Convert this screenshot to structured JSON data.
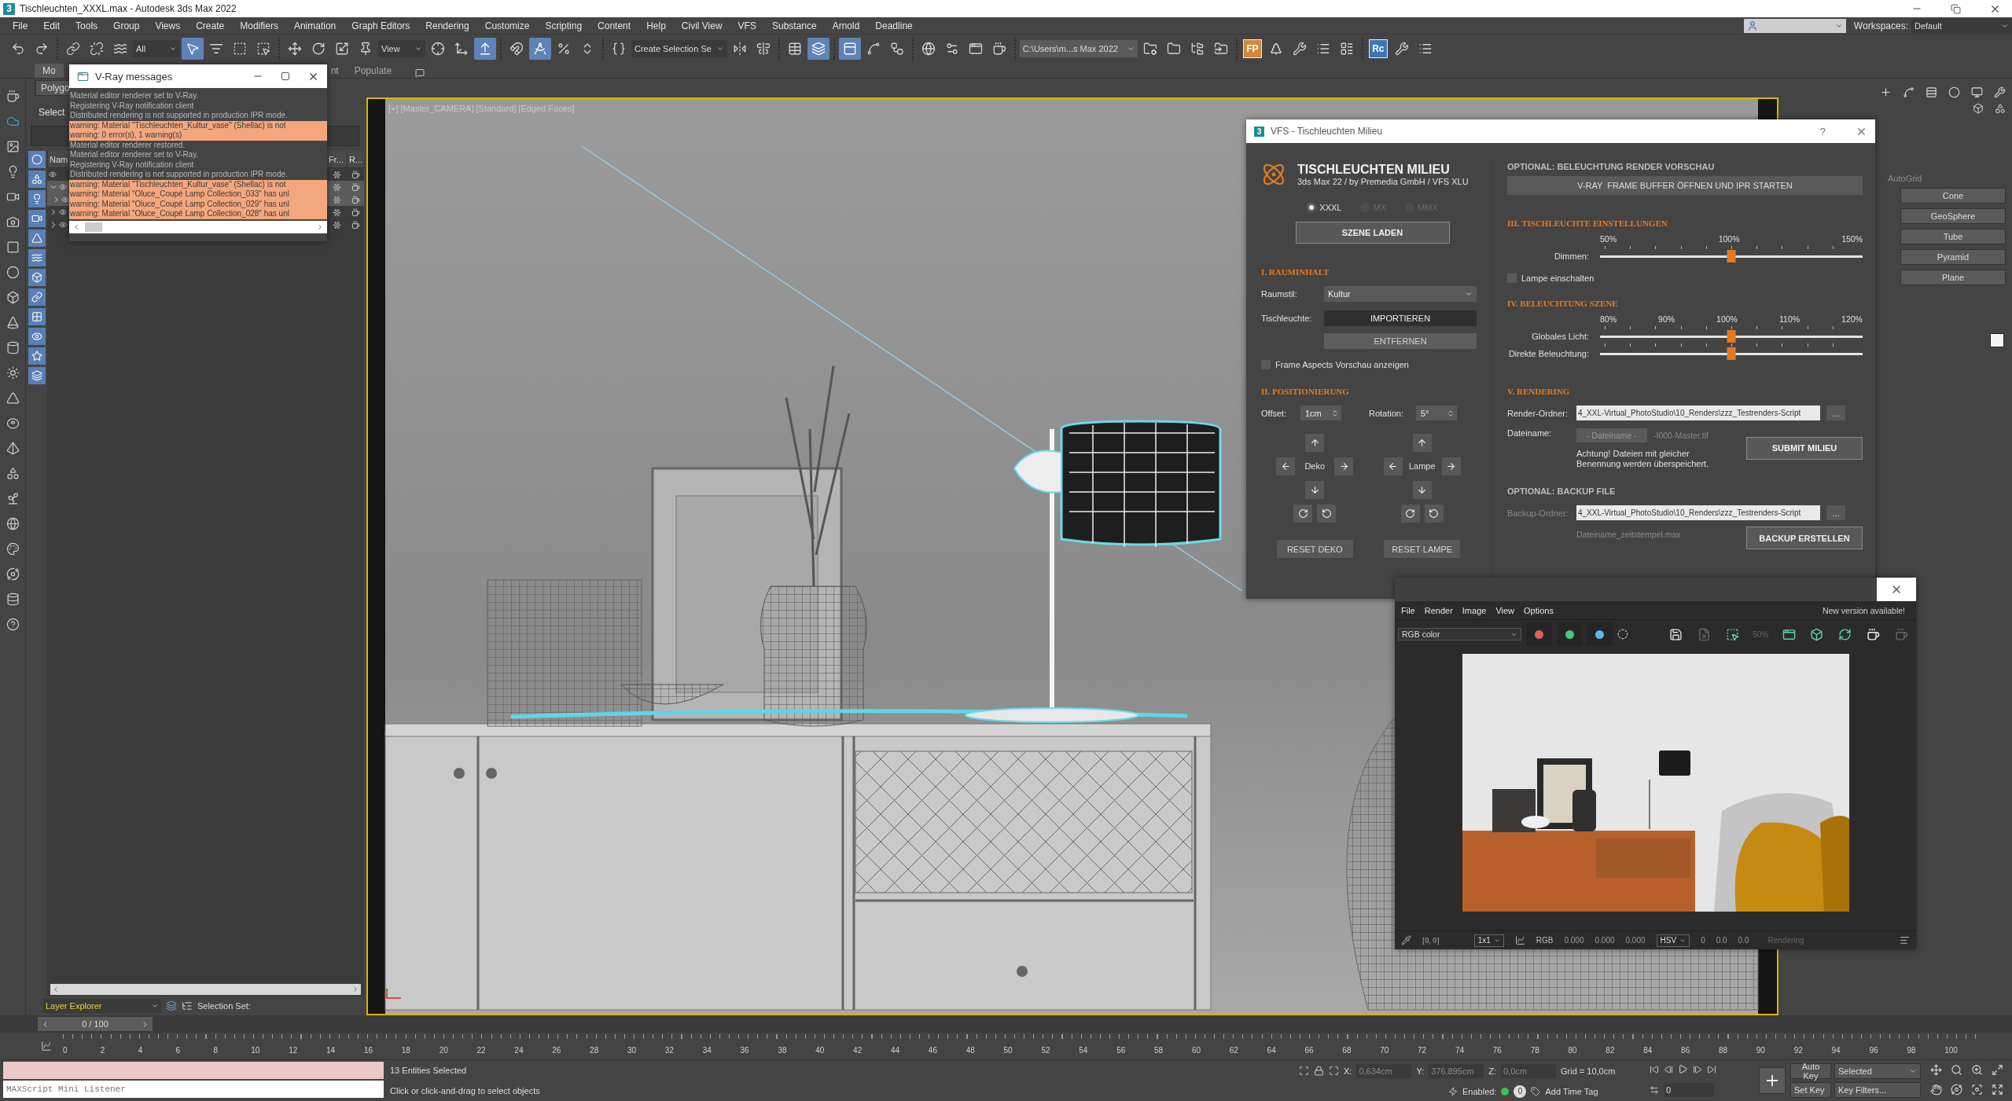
{
  "window": {
    "logo": "3",
    "title": "Tischleuchten_XXXL.max - Autodesk 3ds Max 2022"
  },
  "menu": [
    "File",
    "Edit",
    "Tools",
    "Group",
    "Views",
    "Create",
    "Modifiers",
    "Animation",
    "Graph Editors",
    "Rendering",
    "Customize",
    "Scripting",
    "Content",
    "Help",
    "Civil View",
    "VFS",
    "Substance",
    "Arnold",
    "Deadline"
  ],
  "workspace": {
    "label": "Workspaces:",
    "value": "Default"
  },
  "toolbar": [
    [
      {
        "kind": "button",
        "on": false
      },
      {
        "kind": "button",
        "on": false
      }
    ],
    [
      {
        "kind": "button",
        "on": false
      },
      {
        "kind": "button",
        "on": false
      },
      {
        "kind": "button",
        "on": false
      },
      {
        "kind": "dropdown",
        "value": "All"
      },
      {
        "kind": "button",
        "on": true
      },
      {
        "kind": "button",
        "on": false
      },
      {
        "kind": "button",
        "on": false
      },
      {
        "kind": "button",
        "on": false
      }
    ],
    [
      {
        "kind": "button",
        "on": false
      },
      {
        "kind": "button",
        "on": false
      },
      {
        "kind": "button",
        "on": false
      },
      {
        "kind": "button",
        "on": false
      },
      {
        "kind": "dropdown",
        "value": "View"
      },
      {
        "kind": "button",
        "on": false
      },
      {
        "kind": "button",
        "on": false
      },
      {
        "kind": "button",
        "on": true
      }
    ],
    [
      {
        "kind": "button",
        "on": false
      },
      {
        "kind": "button",
        "on": true
      },
      {
        "kind": "button",
        "on": false
      },
      {
        "kind": "button",
        "on": false
      }
    ],
    [
      {
        "kind": "button",
        "on": false
      },
      {
        "kind": "dropdown",
        "value": "Create Selection Se"
      },
      {
        "kind": "button",
        "on": false
      },
      {
        "kind": "button",
        "on": false
      }
    ],
    [
      {
        "kind": "button",
        "on": false
      },
      {
        "kind": "button",
        "on": true
      }
    ],
    [
      {
        "kind": "button",
        "on": true
      },
      {
        "kind": "button",
        "on": false
      },
      {
        "kind": "button",
        "on": false
      }
    ],
    [
      {
        "kind": "button",
        "on": false
      },
      {
        "kind": "button",
        "on": false
      },
      {
        "kind": "button",
        "on": false
      },
      {
        "kind": "button",
        "on": false
      }
    ],
    [
      {
        "kind": "dropdown",
        "value": "C:\\Users\\m...s Max 2022"
      },
      {
        "kind": "button",
        "on": false
      },
      {
        "kind": "button",
        "on": false
      },
      {
        "kind": "button",
        "on": false
      },
      {
        "kind": "button",
        "on": false
      }
    ],
    [
      {
        "kind": "text",
        "label": "FP",
        "color": "#d0883a"
      },
      {
        "kind": "button",
        "on": false
      },
      {
        "kind": "button",
        "on": false
      },
      {
        "kind": "button",
        "on": false
      },
      {
        "kind": "button",
        "on": false
      }
    ],
    [
      {
        "kind": "text",
        "label": "Rc",
        "color": "#3c78b4"
      },
      {
        "kind": "button",
        "on": false
      },
      {
        "kind": "button",
        "on": false
      }
    ]
  ],
  "ribbon_tabs": [
    {
      "label": "Mo",
      "selected": true
    },
    {
      "label": "nt",
      "selected": false
    },
    {
      "label": "Populate",
      "selected": false
    }
  ],
  "explorer": {
    "ribbon_dropdown": "Polygo",
    "menu": "Select",
    "columns": [
      "Nam",
      "Fr...",
      "R..."
    ],
    "rows": [
      {
        "selected": false
      },
      {
        "expanded": true,
        "selected": true,
        "children": [
          {
            "expanded": false,
            "selected": true
          }
        ]
      },
      {
        "expanded": false,
        "selected": false
      },
      {
        "expanded": false,
        "selected": false
      }
    ],
    "layer_explorer": "Layer Explorer",
    "selection_set": "Selection Set:"
  },
  "vray_messages": {
    "title": "V-Ray messages",
    "lines": [
      {
        "kind": "info",
        "text": "Material editor renderer set to V-Ray."
      },
      {
        "kind": "info",
        "text": "Registering V-Ray notification client"
      },
      {
        "kind": "info",
        "text": "Distributed rendering is not supported in production IPR mode."
      },
      {
        "kind": "warning",
        "text": "warning: Material \"Tischleuchten_Kultur_vase\" (Shellac) is not"
      },
      {
        "kind": "warning",
        "text": "warning: 0 error(s), 1 warning(s)"
      },
      {
        "kind": "info",
        "text": "Material editor renderer restored."
      },
      {
        "kind": "info",
        "text": "Material editor renderer set to V-Ray."
      },
      {
        "kind": "info",
        "text": "Registering V-Ray notification client"
      },
      {
        "kind": "info",
        "text": "Distributed rendering is not supported in production IPR mode."
      },
      {
        "kind": "warning",
        "text": "warning: Material \"Tischleuchten_Kultur_vase\" (Shellac) is not"
      },
      {
        "kind": "warning",
        "text": "warning: Material \"Oluce_Coupé Lamp Collection_033\" has unl"
      },
      {
        "kind": "warning",
        "text": "warning: Material \"Oluce_Coupé Lamp Collection_029\" has unl"
      },
      {
        "kind": "warning",
        "text": "warning: Material \"Oluce_Coupé Lamp Collection_028\" has unl"
      }
    ]
  },
  "viewport": {
    "label": "[+] [Master_CAMERA] [Standard] [Edged Faces]"
  },
  "command_panel": {
    "autogrid": "AutoGrid",
    "primitives": [
      "Cone",
      "GeoSphere",
      "Tube",
      "Pyramid",
      "Plane"
    ]
  },
  "vfs_dialog": {
    "logo": "3",
    "title": "VFS - Tischleuchten Milieu",
    "help": "?",
    "heading": "TISCHLEUCHTEN MILIEU",
    "subheading": "3ds Max 22 / by Premedia GmbH / VFS XLU",
    "versions": [
      {
        "label": "XXXL",
        "selected": true,
        "disabled": false
      },
      {
        "label": "MX",
        "selected": false,
        "disabled": true
      },
      {
        "label": "MMX",
        "selected": false,
        "disabled": true
      }
    ],
    "load_button": "SZENE LADEN",
    "room": {
      "title": "I. RAUMINHALT",
      "style_label": "Raumstil:",
      "style_value": "Kultur",
      "lamp_label": "Tischleuchte:",
      "import_button": {
        "label": "IMPORTIEREN",
        "hovered": true
      },
      "remove_button": "ENTFERNEN",
      "frame_aspects": {
        "label": "Frame Aspects Vorschau anzeigen",
        "checked": false
      }
    },
    "positioning": {
      "title": "II. POSITIONIERUNG",
      "offset_label": "Offset:",
      "offset_value": "1cm",
      "rotation_label": "Rotation:",
      "rotation_value": "5°",
      "pads": [
        {
          "label": "Deko",
          "reset": "RESET DEKO"
        },
        {
          "label": "Lampe",
          "reset": "RESET LAMPE"
        }
      ]
    },
    "preview": {
      "title": "OPTIONAL: BELEUCHTUNG RENDER VORSCHAU",
      "button": "V-RAY  FRAME BUFFER ÖFFNEN UND IPR STARTEN"
    },
    "lamp_settings": {
      "title": "III. TISCHLEUCHTE EINSTELLUNGEN",
      "ticks": [
        "50%",
        "100%",
        "150%"
      ],
      "sliders": [
        {
          "label": "Dimmen:",
          "level": 0.5
        }
      ],
      "lamp_on": {
        "label": "Lampe einschalten",
        "checked": false
      }
    },
    "scene_lighting": {
      "title": "IV. BELEUCHTUNG SZENE",
      "ticks": [
        "80%",
        "90%",
        "100%",
        "110%",
        "120%"
      ],
      "sliders": [
        {
          "label": "Globales Licht:",
          "level": 0.5
        },
        {
          "label": "Direkte Beleuchtung:",
          "level": 0.5
        }
      ]
    },
    "rendering": {
      "title": "V. RENDERING",
      "folder_label": "Render-Ordner:",
      "folder_value": "4_XXL-Virtual_PhotoStudio\\10_Renders\\zzz_Testrenders-Script",
      "browse": "...",
      "filename_label": "Dateiname:",
      "filename_placeholder": "- Dateiname -",
      "filename_suffix": "-I000-Master.tif",
      "submit": "SUBMIT MILIEU",
      "warning": "Achtung! Dateien mit gleicher Benennung werden überspeichert."
    },
    "backup": {
      "title": "OPTIONAL: BACKUP FILE",
      "folder_label": "Backup-Ordner:",
      "disabled": true,
      "folder_value": "4_XXL-Virtual_PhotoStudio\\10_Renders\\zzz_Testrenders-Script",
      "browse": "...",
      "filename": "Dateiname_zeitstempel.max",
      "button": "BACKUP ERSTELLEN"
    }
  },
  "frame_buffer": {
    "menu": [
      "File",
      "Render",
      "Image",
      "View",
      "Options"
    ],
    "notice": "New version available!",
    "channel": "RGB color",
    "channel_buttons": [
      {
        "color": "#e0605a"
      },
      {
        "color": "#4fc37a"
      },
      {
        "color": "#5cb8e6"
      }
    ],
    "zoom_icon_label": "50%",
    "coords": "[0, 0]",
    "zoom": "1x1",
    "color_mode": "RGB",
    "rgb_values": [
      "0.000",
      "0.000",
      "0.000"
    ],
    "hsv_mode": "HSV",
    "hsv_values": [
      "0",
      "0.0",
      "0.0"
    ],
    "status": "Rendering"
  },
  "timeline": {
    "position": "0 / 100",
    "level": 0,
    "ticks": [
      "0",
      "2",
      "4",
      "6",
      "8",
      "10",
      "12",
      "14",
      "16",
      "18",
      "20",
      "22",
      "24",
      "26",
      "28",
      "30",
      "32",
      "34",
      "36",
      "38",
      "40",
      "42",
      "44",
      "46",
      "48",
      "50",
      "52",
      "54",
      "56",
      "58",
      "60",
      "62",
      "64",
      "66",
      "68",
      "70",
      "72",
      "74",
      "76",
      "78",
      "80",
      "82",
      "84",
      "86",
      "88",
      "90",
      "92",
      "94",
      "96",
      "98",
      "100"
    ]
  },
  "status": {
    "listener": "MAXScript Mini Listener",
    "selection": "13 Entities Selected",
    "prompt": "Click or click-and-drag to select objects",
    "x_label": "X:",
    "x": "0,634cm",
    "y_label": "Y:",
    "y": "376,895cm",
    "z_label": "Z:",
    "z": "0,0cm",
    "grid": "Grid = 10,0cm",
    "enabled_label": "Enabled:",
    "badge": "0",
    "time_tag": "Add Time Tag",
    "frame": "0",
    "auto_key": "Auto Key",
    "key_mode": "Selected",
    "set_key": "Set Key",
    "key_filters": "Key Filters..."
  }
}
